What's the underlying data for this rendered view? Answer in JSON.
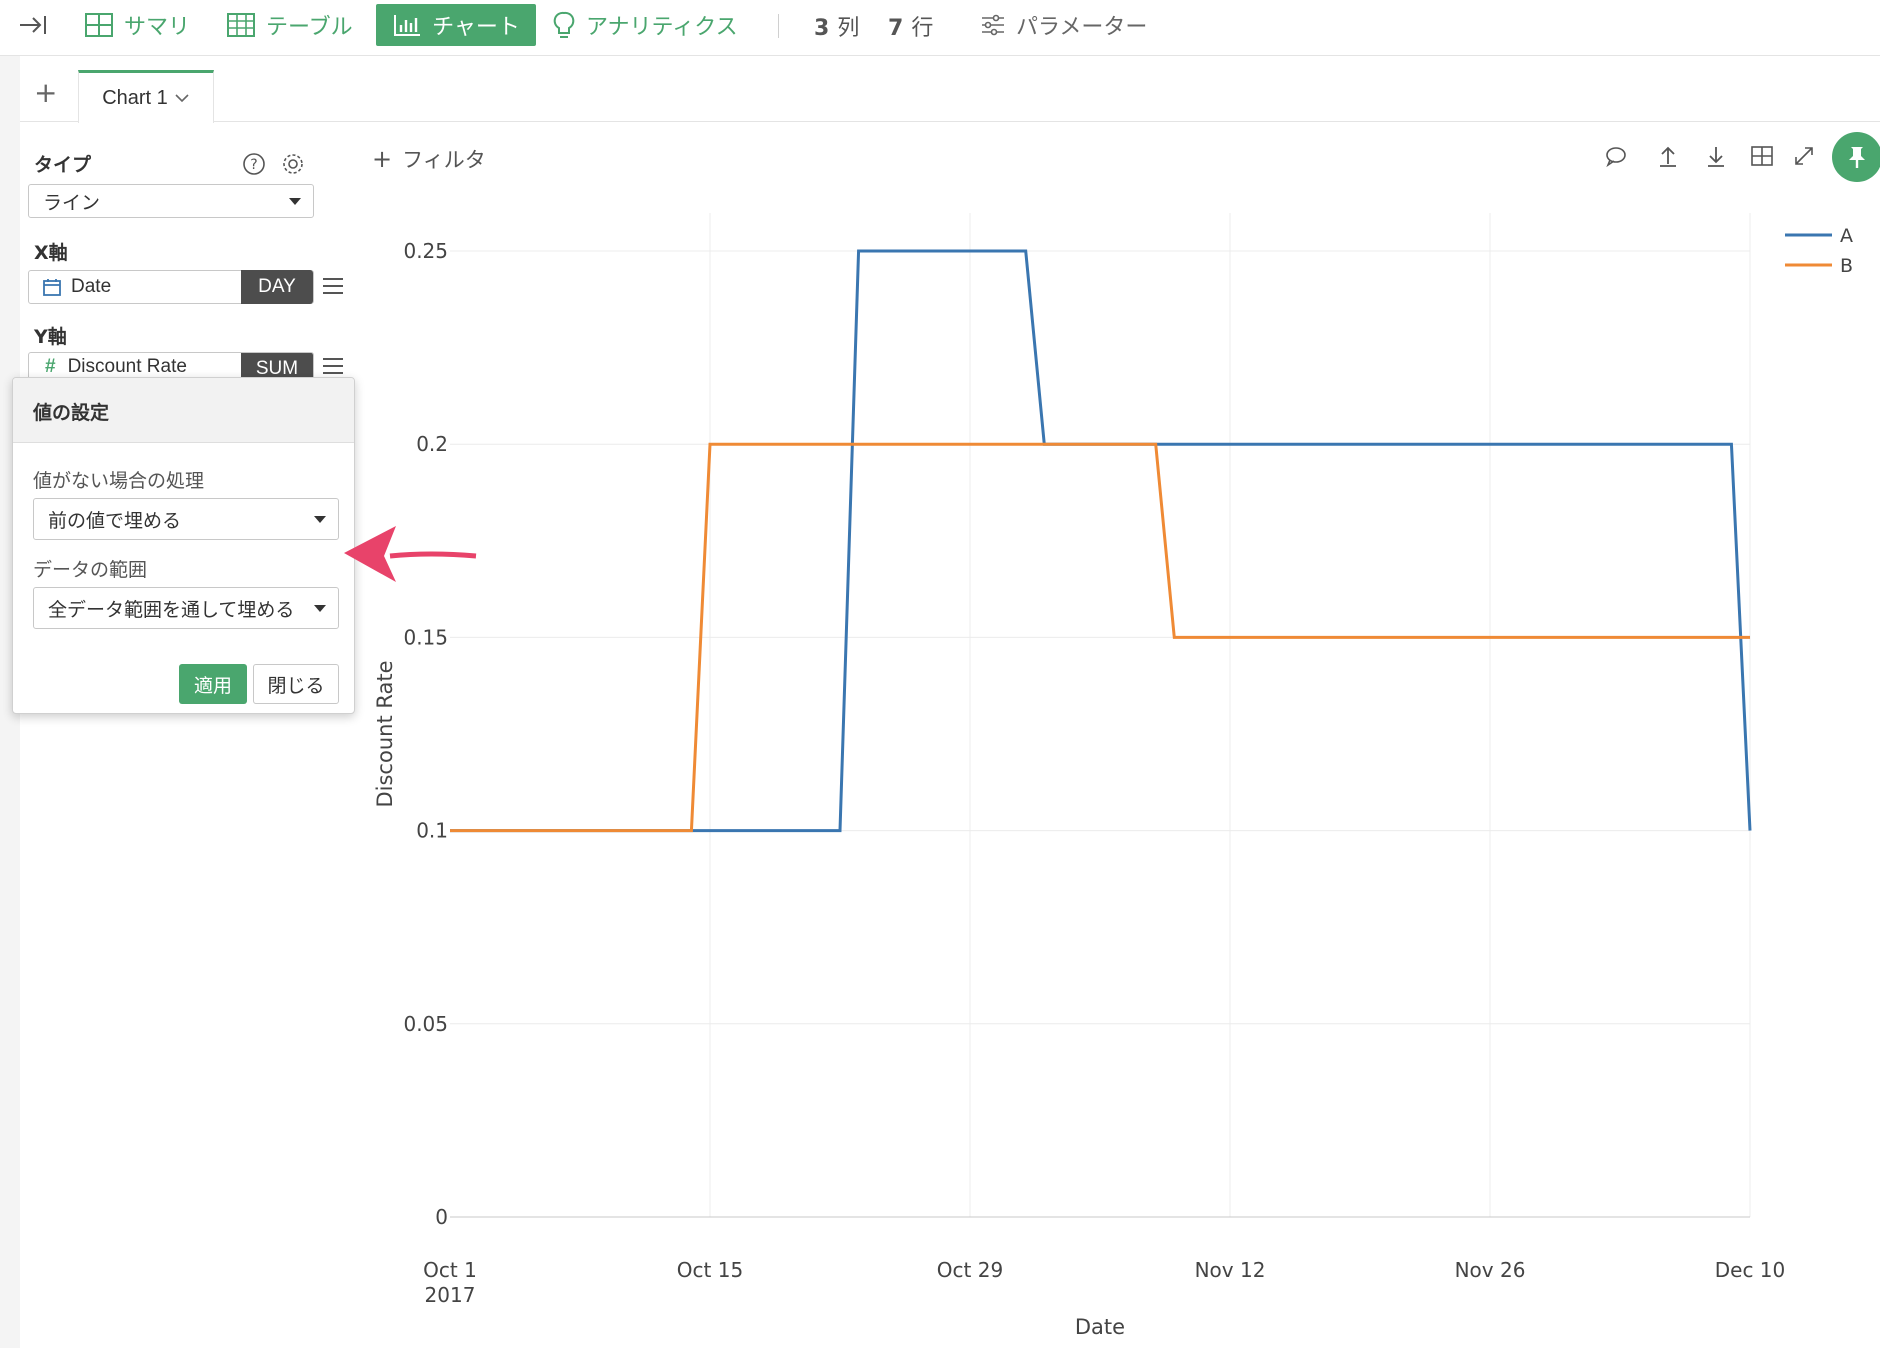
{
  "toolbar": {
    "summary": "サマリ",
    "table": "テーブル",
    "chart": "チャート",
    "analytics": "アナリティクス",
    "columns_count": "3",
    "columns_unit": "列",
    "rows_count": "7",
    "rows_unit": "行",
    "parameters": "パラメーター"
  },
  "tabs": {
    "add": "+",
    "active_tab": "Chart 1"
  },
  "sidebar": {
    "type_label": "タイプ",
    "type_value": "ライン",
    "x_label": "X軸",
    "x_field": "Date",
    "x_agg": "DAY",
    "y_label": "Y軸",
    "y_field": "Discount Rate",
    "y_agg": "SUM"
  },
  "popup": {
    "title": "値の設定",
    "missing_label": "値がない場合の処理",
    "missing_value": "前の値で埋める",
    "range_label": "データの範囲",
    "range_value": "全データ範囲を通して埋める",
    "apply": "適用",
    "close": "閉じる"
  },
  "chart_area": {
    "filter": "フィルタ"
  },
  "colors": {
    "accent": "#4aa66e",
    "series_a": "#3a76b0",
    "series_b": "#ef8a35",
    "arrow": "#e8436a"
  },
  "icons": [
    "collapse-icon",
    "grid-icon",
    "table-icon",
    "bar-chart-icon",
    "lightbulb-icon",
    "sliders-icon",
    "question-icon",
    "gear-icon",
    "calendar-icon",
    "hash-icon",
    "menu-icon",
    "comment-icon",
    "upload-icon",
    "download-icon",
    "table-view-icon",
    "expand-icon",
    "pin-icon"
  ],
  "chart_data": {
    "type": "line",
    "xlabel": "Date",
    "ylabel": "Discount Rate",
    "x_ticks": [
      "Oct 1|2017",
      "Oct 15",
      "Oct 29",
      "Nov 12",
      "Nov 26",
      "Dec 10"
    ],
    "x_tick_dates": [
      "2017-10-01",
      "2017-10-15",
      "2017-10-29",
      "2017-11-12",
      "2017-11-26",
      "2017-12-10"
    ],
    "y_ticks": [
      "0",
      "0.05",
      "0.1",
      "0.15",
      "0.2",
      "0.25"
    ],
    "ylim": [
      0,
      0.25
    ],
    "xlim": [
      "2017-10-01",
      "2017-12-10"
    ],
    "grid": true,
    "legend": "top-right",
    "series": [
      {
        "name": "A",
        "color": "#3a76b0",
        "points": [
          [
            "2017-10-01",
            0.1
          ],
          [
            "2017-10-22",
            0.1
          ],
          [
            "2017-10-23",
            0.25
          ],
          [
            "2017-11-01",
            0.25
          ],
          [
            "2017-11-02",
            0.2
          ],
          [
            "2017-12-09",
            0.2
          ],
          [
            "2017-12-10",
            0.1
          ]
        ]
      },
      {
        "name": "B",
        "color": "#ef8a35",
        "points": [
          [
            "2017-10-01",
            0.1
          ],
          [
            "2017-10-14",
            0.1
          ],
          [
            "2017-10-15",
            0.2
          ],
          [
            "2017-11-08",
            0.2
          ],
          [
            "2017-11-09",
            0.15
          ],
          [
            "2017-12-10",
            0.15
          ]
        ]
      }
    ]
  }
}
